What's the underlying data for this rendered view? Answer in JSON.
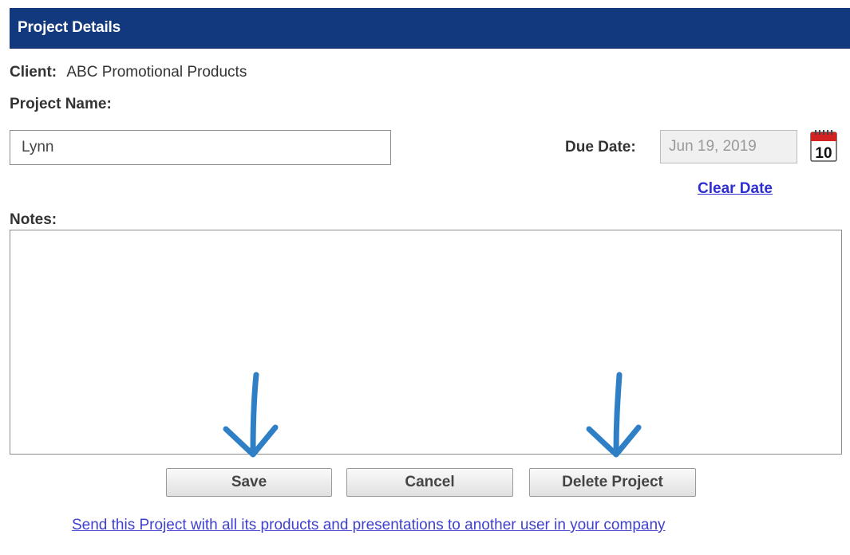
{
  "header": {
    "title": "Project Details"
  },
  "client": {
    "label": "Client:",
    "value": "ABC Promotional Products"
  },
  "project_name": {
    "label": "Project Name:",
    "value": "Lynn"
  },
  "due_date": {
    "label": "Due Date:",
    "value": "Jun 19, 2019",
    "calendar_day": "10"
  },
  "clear_date_label": "Clear Date",
  "notes": {
    "label": "Notes:",
    "value": ""
  },
  "buttons": {
    "save": "Save",
    "cancel": "Cancel",
    "delete": "Delete Project"
  },
  "send_link": "Send this Project with all its products and presentations to another user in your company",
  "colors": {
    "header_bg": "#12397e",
    "link": "#2e2ed1",
    "arrow": "#2f7fc6"
  }
}
